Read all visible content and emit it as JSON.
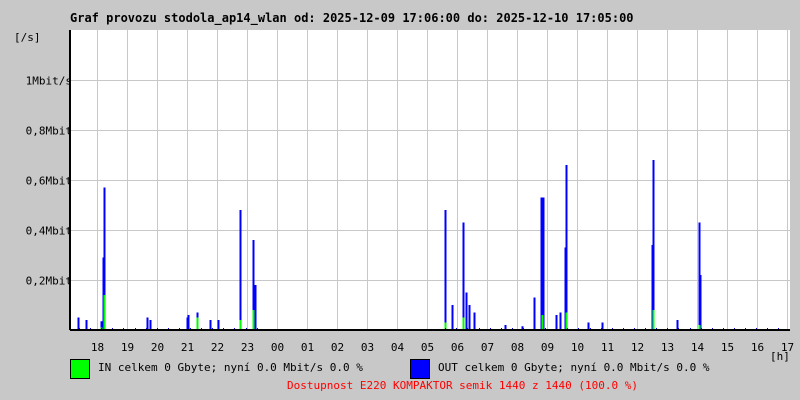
{
  "title": "Graf provozu stodola_ap14_wlan od: 2025-12-09 17:06:00 do: 2025-12-10 17:05:00",
  "legend": {
    "in_text": "IN celkem 0 Gbyte; nyní   0.0 Mbit/s 0.0 %",
    "out_text": "OUT celkem 0 Gbyte; nyní   0.0 Mbit/s 0.0 %",
    "availability": "Dostupnost E220 KOMPAKTOR semik 1440 z 1440 (100.0 %)"
  },
  "colors": {
    "in": "#00ff00",
    "out": "#0000ff",
    "grid": "#c8c8c8",
    "availability": "#ff0000"
  },
  "chart_data": {
    "type": "bar",
    "title": "Graf provozu stodola_ap14_wlan",
    "ylabel": "[/s]",
    "xlabel": "[h]",
    "ylim": [
      0,
      1.2
    ],
    "xlim_hours": [
      0,
      24
    ],
    "y_ticks": [
      {
        "v": 0.2,
        "label": "0,2Mbit"
      },
      {
        "v": 0.4,
        "label": "0,4Mbit"
      },
      {
        "v": 0.6,
        "label": "0,6Mbit"
      },
      {
        "v": 0.8,
        "label": "0,8Mbit"
      },
      {
        "v": 1.0,
        "label": "1Mbit/s"
      }
    ],
    "x_ticks": [
      {
        "h": 0.9,
        "label": "18"
      },
      {
        "h": 1.9,
        "label": "19"
      },
      {
        "h": 2.9,
        "label": "20"
      },
      {
        "h": 3.9,
        "label": "21"
      },
      {
        "h": 4.9,
        "label": "22"
      },
      {
        "h": 5.9,
        "label": "23"
      },
      {
        "h": 6.9,
        "label": "00"
      },
      {
        "h": 7.9,
        "label": "01"
      },
      {
        "h": 8.9,
        "label": "02"
      },
      {
        "h": 9.9,
        "label": "03"
      },
      {
        "h": 10.9,
        "label": "04"
      },
      {
        "h": 11.9,
        "label": "05"
      },
      {
        "h": 12.9,
        "label": "06"
      },
      {
        "h": 13.9,
        "label": "07"
      },
      {
        "h": 14.9,
        "label": "08"
      },
      {
        "h": 15.9,
        "label": "09"
      },
      {
        "h": 16.9,
        "label": "10"
      },
      {
        "h": 17.9,
        "label": "11"
      },
      {
        "h": 18.9,
        "label": "12"
      },
      {
        "h": 19.9,
        "label": "13"
      },
      {
        "h": 20.9,
        "label": "14"
      },
      {
        "h": 21.9,
        "label": "15"
      },
      {
        "h": 22.9,
        "label": "16"
      },
      {
        "h": 23.9,
        "label": "17"
      }
    ],
    "series": [
      {
        "name": "OUT",
        "unit": "Mbit/s",
        "points": [
          [
            0.27,
            0.05
          ],
          [
            0.53,
            0.04
          ],
          [
            1.03,
            0.035
          ],
          [
            1.1,
            0.29
          ],
          [
            1.13,
            0.57
          ],
          [
            2.57,
            0.05
          ],
          [
            2.67,
            0.04
          ],
          [
            3.9,
            0.05
          ],
          [
            3.93,
            0.06
          ],
          [
            4.23,
            0.07
          ],
          [
            4.67,
            0.04
          ],
          [
            4.93,
            0.04
          ],
          [
            5.67,
            0.48
          ],
          [
            6.1,
            0.36
          ],
          [
            6.17,
            0.18
          ],
          [
            12.5,
            0.48
          ],
          [
            12.73,
            0.1
          ],
          [
            13.1,
            0.43
          ],
          [
            13.2,
            0.15
          ],
          [
            13.3,
            0.1
          ],
          [
            13.47,
            0.07
          ],
          [
            14.5,
            0.02
          ],
          [
            15.07,
            0.015
          ],
          [
            15.47,
            0.13
          ],
          [
            15.7,
            0.53
          ],
          [
            15.77,
            0.53
          ],
          [
            16.2,
            0.06
          ],
          [
            16.33,
            0.07
          ],
          [
            16.53,
            0.66
          ],
          [
            16.5,
            0.33
          ],
          [
            17.27,
            0.03
          ],
          [
            17.73,
            0.03
          ],
          [
            19.43,
            0.68
          ],
          [
            19.4,
            0.34
          ],
          [
            20.23,
            0.04
          ],
          [
            20.97,
            0.43
          ],
          [
            21.0,
            0.22
          ]
        ]
      },
      {
        "name": "IN",
        "unit": "Mbit/s",
        "points": [
          [
            1.03,
            0.01
          ],
          [
            1.13,
            0.14
          ],
          [
            4.23,
            0.05
          ],
          [
            5.67,
            0.04
          ],
          [
            6.1,
            0.08
          ],
          [
            12.5,
            0.03
          ],
          [
            13.1,
            0.05
          ],
          [
            15.73,
            0.06
          ],
          [
            16.53,
            0.07
          ],
          [
            19.43,
            0.08
          ],
          [
            20.97,
            0.02
          ]
        ]
      }
    ]
  }
}
